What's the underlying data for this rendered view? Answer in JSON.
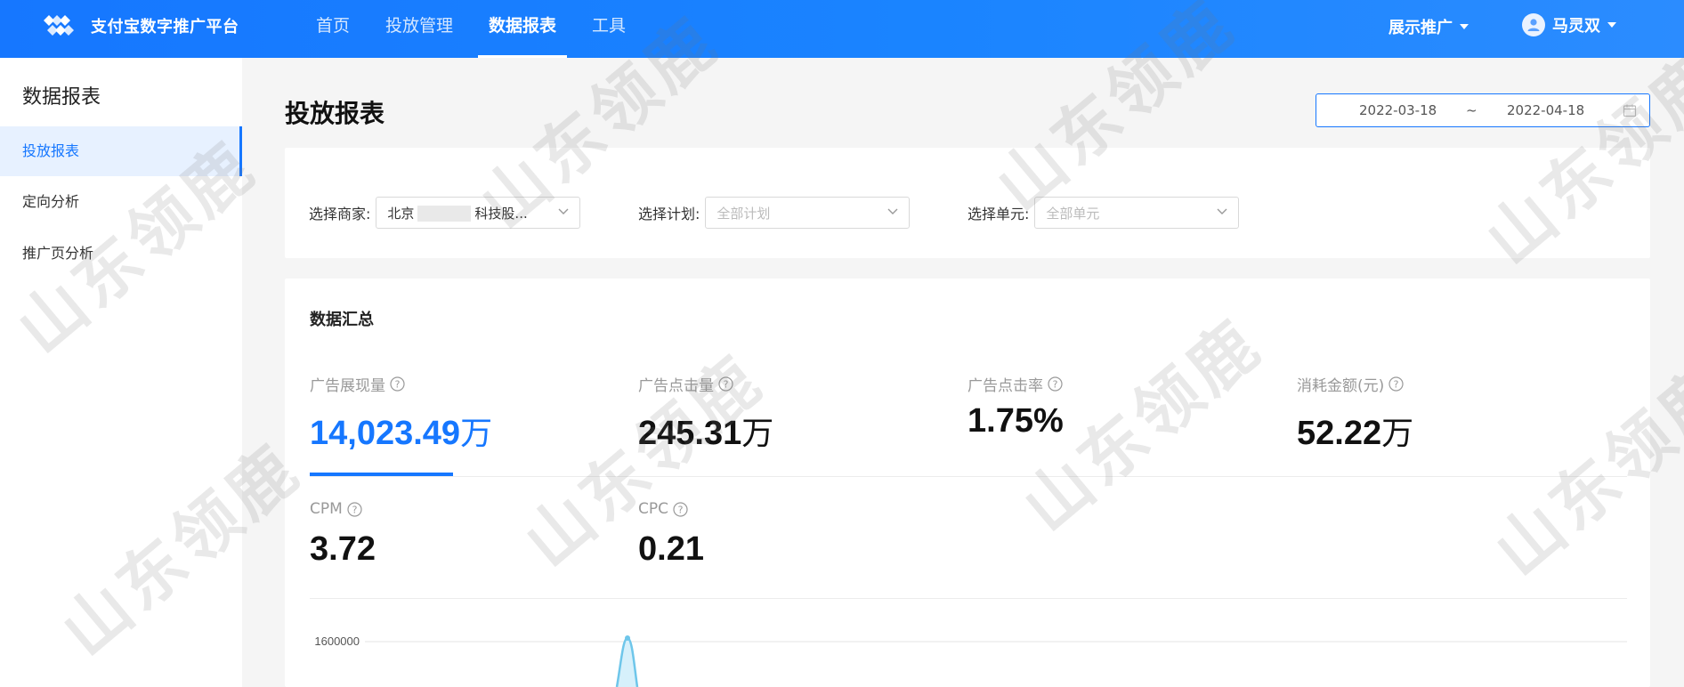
{
  "brand": {
    "name": "支付宝数字推广平台",
    "logo_icon": "alipay-logo-icon"
  },
  "nav": {
    "items": [
      {
        "label": "首页",
        "active": false
      },
      {
        "label": "投放管理",
        "active": false
      },
      {
        "label": "数据报表",
        "active": true
      },
      {
        "label": "工具",
        "active": false
      }
    ],
    "promo_label": "展示推广",
    "user_name": "马灵双"
  },
  "sidebar": {
    "title": "数据报表",
    "items": [
      {
        "label": "投放报表",
        "active": true
      },
      {
        "label": "定向分析",
        "active": false
      },
      {
        "label": "推广页分析",
        "active": false
      }
    ]
  },
  "main": {
    "title": "投放报表",
    "date_range": {
      "start": "2022-03-18",
      "separator": "~",
      "end": "2022-04-18"
    }
  },
  "filters": {
    "merchant": {
      "label": "选择商家:",
      "value_prefix": "北京",
      "value_suffix": "科技股..."
    },
    "plan": {
      "label": "选择计划:",
      "placeholder": "全部计划"
    },
    "unit": {
      "label": "选择单元:",
      "placeholder": "全部单元"
    }
  },
  "summary": {
    "title": "数据汇总",
    "metrics": [
      {
        "label": "广告展现量",
        "number": "14,023.49",
        "unit": "万",
        "active": true
      },
      {
        "label": "广告点击量",
        "number": "245.31",
        "unit": "万",
        "active": false
      },
      {
        "label": "广告点击率",
        "number": "1.75%",
        "unit": "",
        "active": false
      },
      {
        "label": "消耗金额(元)",
        "number": "52.22",
        "unit": "万",
        "active": false
      },
      {
        "label": "CPM",
        "number": "3.72",
        "unit": "",
        "active": false
      },
      {
        "label": "CPC",
        "number": "0.21",
        "unit": "",
        "active": false
      }
    ]
  },
  "chart_data": {
    "type": "line",
    "y_tick_labels": [
      "1600000"
    ],
    "series_color": "#6ec6ea"
  },
  "watermark": {
    "text": "山东领鹿"
  },
  "colors": {
    "primary": "#1677ff",
    "active_bg": "#e7f1ff"
  }
}
